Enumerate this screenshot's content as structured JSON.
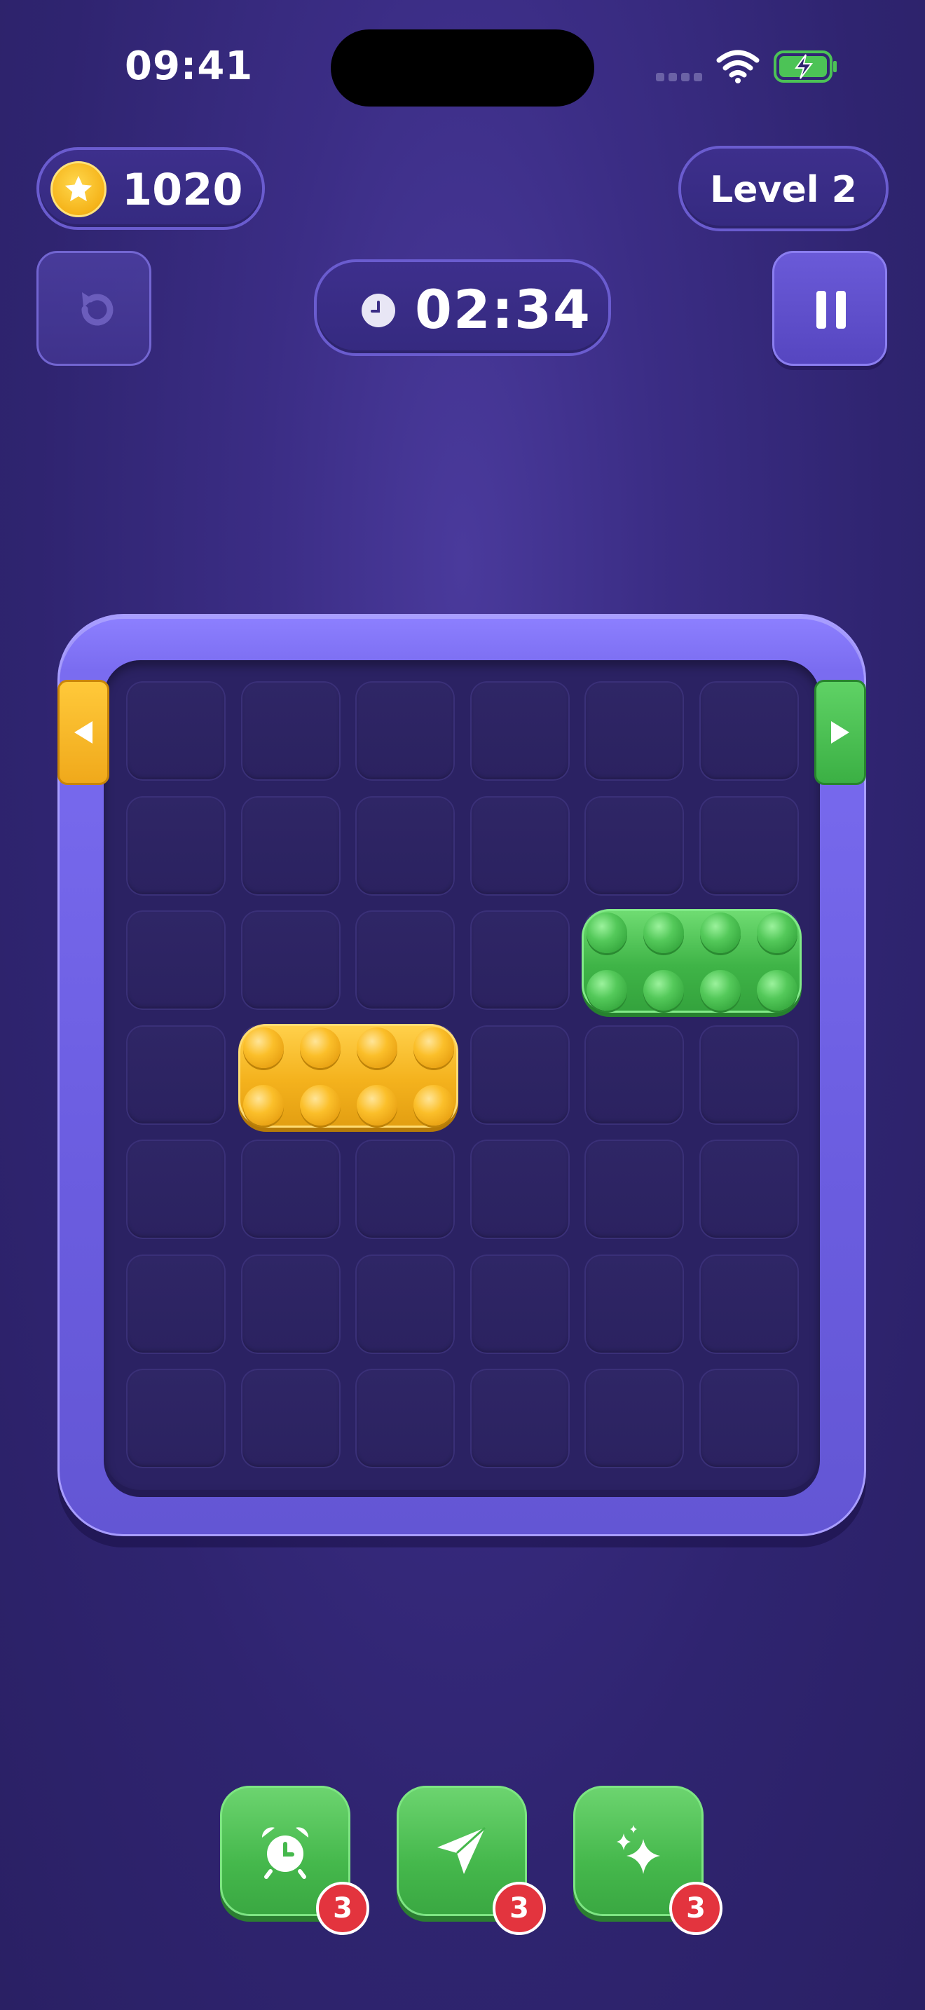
{
  "status_bar": {
    "time": "09:41"
  },
  "header": {
    "coins": "1020",
    "level": "Level 2",
    "timer": "02:34"
  },
  "board": {
    "rows": 7,
    "cols": 6,
    "pieces": [
      {
        "name": "green-block",
        "color": "#3fb447",
        "row": 3,
        "col": 5,
        "length": 2
      },
      {
        "name": "yellow-block",
        "color": "#f4b21d",
        "row": 4,
        "col": 2,
        "length": 2
      }
    ],
    "gates": [
      {
        "side": "left",
        "row": 1,
        "color": "#f4b21d"
      },
      {
        "side": "right",
        "row": 1,
        "color": "#3fb447"
      }
    ]
  },
  "boosters": [
    {
      "icon": "alarm-clock-icon",
      "count": "3"
    },
    {
      "icon": "paper-plane-icon",
      "count": "3"
    },
    {
      "icon": "sparkles-icon",
      "count": "3"
    }
  ]
}
